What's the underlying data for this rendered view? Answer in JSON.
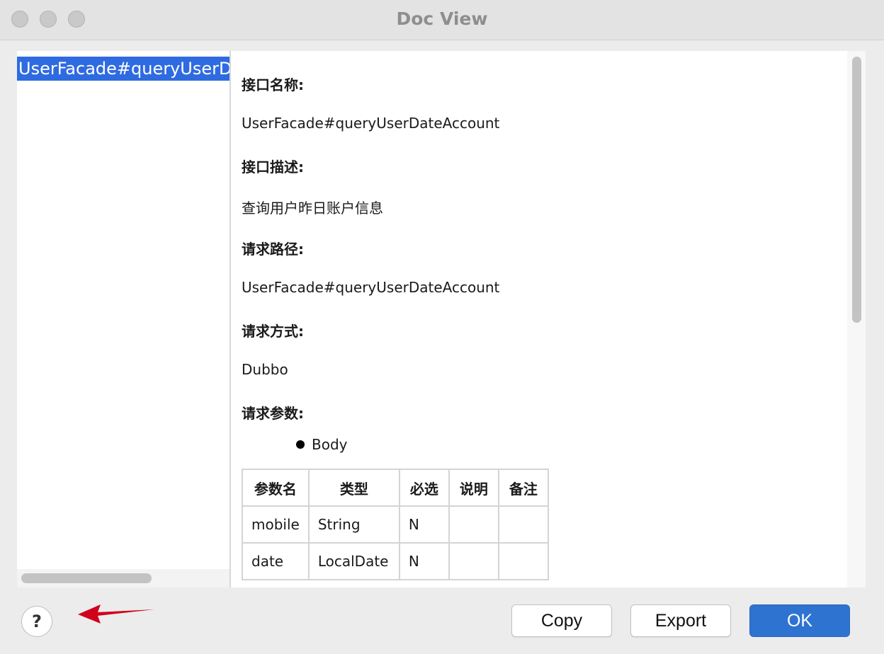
{
  "window": {
    "title": "Doc View"
  },
  "left_panel": {
    "items": [
      {
        "label": "UserFacade#queryUserDateAccount",
        "selected": true
      }
    ]
  },
  "doc": {
    "interface_name_label": "接口名称:",
    "interface_name_value": "UserFacade#queryUserDateAccount",
    "interface_desc_label": "接口描述:",
    "interface_desc_value": "查询用户昨日账户信息",
    "request_path_label": "请求路径:",
    "request_path_value": "UserFacade#queryUserDateAccount",
    "request_method_label": "请求方式:",
    "request_method_value": "Dubbo",
    "request_params_label": "请求参数:",
    "body_label": "Body",
    "params_table": {
      "headers": [
        "参数名",
        "类型",
        "必选",
        "说明",
        "备注"
      ],
      "rows": [
        [
          "mobile",
          "String",
          "N",
          "",
          ""
        ],
        [
          "date",
          "LocalDate",
          "N",
          "",
          ""
        ]
      ]
    }
  },
  "footer": {
    "help_label": "?",
    "copy_label": "Copy",
    "export_label": "Export",
    "ok_label": "OK"
  },
  "colors": {
    "selection": "#2f6be0",
    "primary_button": "#2f73d1",
    "annotation_arrow": "#d0021b"
  }
}
